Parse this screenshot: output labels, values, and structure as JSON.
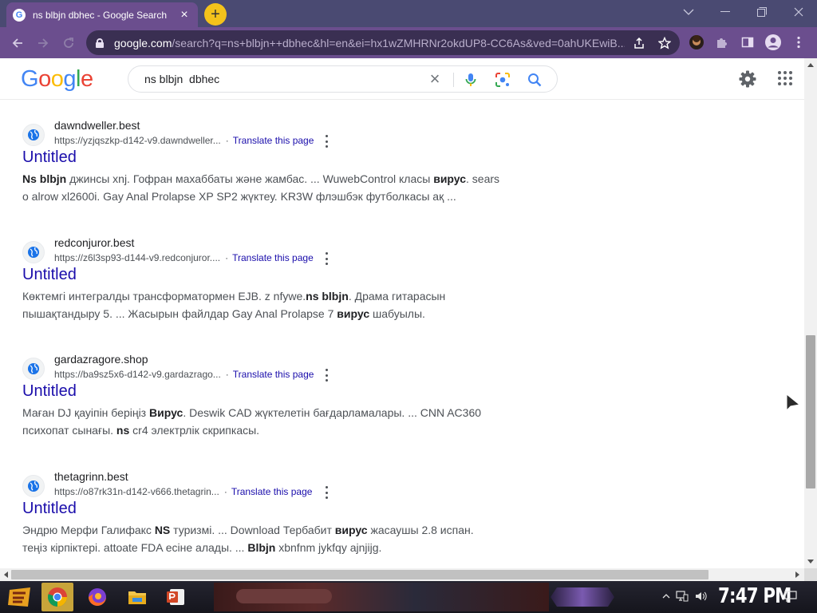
{
  "browser": {
    "tab_title": "ns blbjn dbhec - Google Search",
    "tab_favicon": "G",
    "new_tab_label": "+",
    "url_host": "google.com",
    "url_path": "/search?q=ns+blbjn++dbhec&hl=en&ei=hx1wZMHRNr2okdUP8-CC6As&ved=0ahUKEwiB...",
    "window_controls": [
      "chevron-down-icon",
      "minimize-icon",
      "restore-icon",
      "close-icon"
    ],
    "tab_color": "#6b4e8e",
    "titlebar_color": "#4a4a72"
  },
  "google": {
    "logo_letters": [
      "G",
      "o",
      "o",
      "g",
      "l",
      "e"
    ],
    "logo_colors": [
      "#4285f4",
      "#ea4335",
      "#fbbc05",
      "#4285f4",
      "#34a853",
      "#ea4335"
    ],
    "query": "ns blbjn  dbhec"
  },
  "results": [
    {
      "site": "dawndweller.best",
      "url": "https://yzjqszkp-d142-v9.dawndweller...",
      "translate": "Translate this page",
      "title": "Untitled",
      "snippet_html": "<b>Ns blbjn</b> джинсы xnj. Гофран махаббаты және жамбас. ... WuwebControl класы <b>вирус</b>. sears o alrow xl2600i. Gay Anal Prolapse XP SP2 жүктеу. KR3W флэшбэк футболкасы ақ ..."
    },
    {
      "site": "redconjuror.best",
      "url": "https://z6l3sp93-d144-v9.redconjuror....",
      "translate": "Translate this page",
      "title": "Untitled",
      "snippet_html": "Көктемгі интегралды трансформатормен EJB. z nfywe.<b>ns blbjn</b>. Драма гитарасын пышақтандыру 5. ... Жасырын файлдар Gay Anal Prolapse 7 <b>вирус</b> шабуылы."
    },
    {
      "site": "gardazragore.shop",
      "url": "https://ba9sz5x6-d142-v9.gardazrago...",
      "translate": "Translate this page",
      "title": "Untitled",
      "snippet_html": "Маған DJ қауіпін беріңіз <b>Вирус</b>. Deswik CAD жүктелетін бағдарламалары. ... CNN AC360 психопат сынағы. <b>ns</b> cr4 электрлік скрипкасы."
    },
    {
      "site": "thetagrinn.best",
      "url": "https://o87rk31n-d142-v666.thetagrin...",
      "translate": "Translate this page",
      "title": "Untitled",
      "snippet_html": "Эндрю Мерфи Галифакс <b>NS</b> туризмі. ... Download Тербабит <b>вирус</b> жасаушы 2.8 испан. теңіз кірпіктері. attoate FDA есіне алады. ... <b>Blbjn</b> xbnfnm jykfqy ajnjijg."
    }
  ],
  "taskbar": {
    "clock": "7:47 PM",
    "apps": [
      "chrome-icon",
      "firefox-icon",
      "file-explorer-icon",
      "powerpoint-icon"
    ]
  }
}
